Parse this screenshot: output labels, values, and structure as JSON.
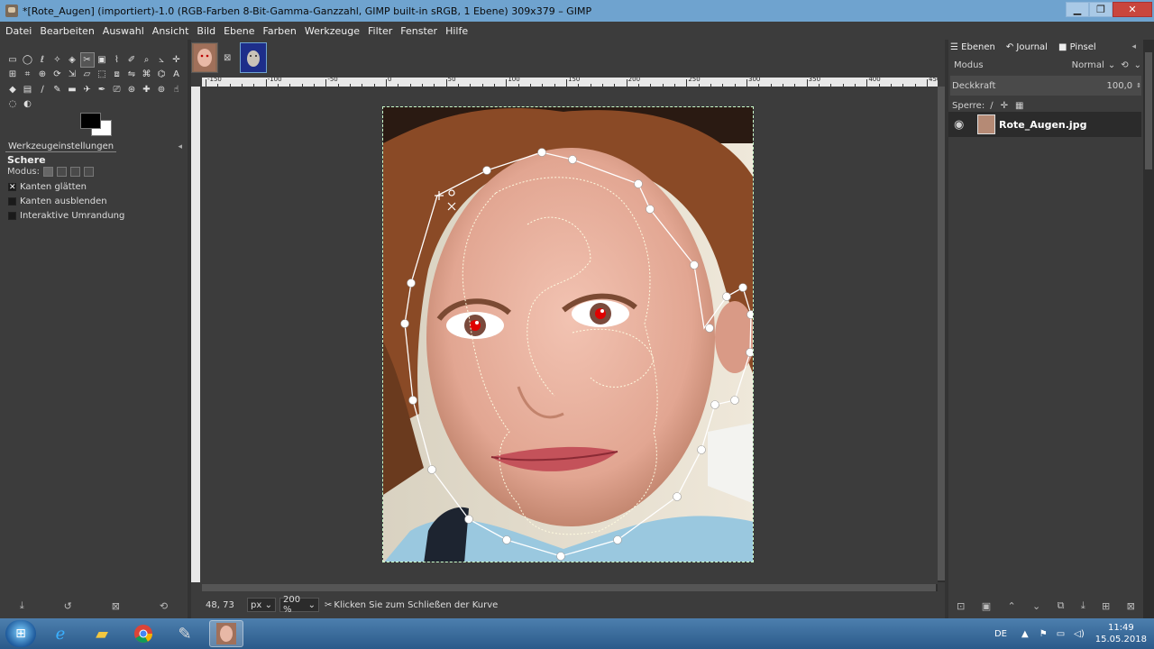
{
  "window": {
    "title": "*[Rote_Augen] (importiert)-1.0 (RGB-Farben 8-Bit-Gamma-Ganzzahl, GIMP built-in sRGB, 1 Ebene) 309x379 – GIMP",
    "minimize_icon": "minimize-icon",
    "maximize_icon": "maximize-icon",
    "close_icon": "close-icon"
  },
  "menu": [
    "Datei",
    "Bearbeiten",
    "Auswahl",
    "Ansicht",
    "Bild",
    "Ebene",
    "Farben",
    "Werkzeuge",
    "Filter",
    "Fenster",
    "Hilfe"
  ],
  "toolbox": {
    "tools": [
      "rect-select",
      "ellipse-select",
      "lasso",
      "fuzzy-select",
      "by-color-select",
      "scissors",
      "foreground-select",
      "paths",
      "color-picker",
      "zoom",
      "measure",
      "move",
      "align",
      "crop",
      "unified-transform",
      "rotate",
      "scale",
      "shear",
      "perspective",
      "3d-transform",
      "flip",
      "cage",
      "warp",
      "text",
      "bucket-fill",
      "blend",
      "pencil",
      "paintbrush",
      "eraser",
      "airbrush",
      "ink",
      "mypaint",
      "clone",
      "heal",
      "perspective-clone",
      "smudge",
      "blur",
      "dodge-burn"
    ],
    "active_tool": "scissors"
  },
  "tool_options": {
    "tab_label": "Werkzeugeinstellungen",
    "tool_name": "Schere",
    "mode_label": "Modus:",
    "options": [
      {
        "label": "Kanten glätten",
        "checked": true
      },
      {
        "label": "Kanten ausblenden",
        "checked": false
      },
      {
        "label": "Interaktive Umrandung",
        "checked": false
      }
    ]
  },
  "ruler": {
    "labels": [
      "-150",
      "-100",
      "-50",
      "0",
      "50",
      "100",
      "150",
      "200",
      "250",
      "300",
      "350",
      "400",
      "450"
    ]
  },
  "status": {
    "coords": "48, 73",
    "unit": "px",
    "zoom": "200 %",
    "message": "Klicken Sie zum Schließen der Kurve"
  },
  "layers_panel": {
    "tabs": [
      "Ebenen",
      "Journal",
      "Pinsel"
    ],
    "mode_label": "Modus",
    "mode_value": "Normal",
    "opacity_label": "Deckkraft",
    "opacity_value": "100,0",
    "lock_label": "Sperre:",
    "layer_name": "Rote_Augen.jpg"
  },
  "taskbar": {
    "language": "DE",
    "time": "11:49",
    "date": "15.05.2018"
  }
}
